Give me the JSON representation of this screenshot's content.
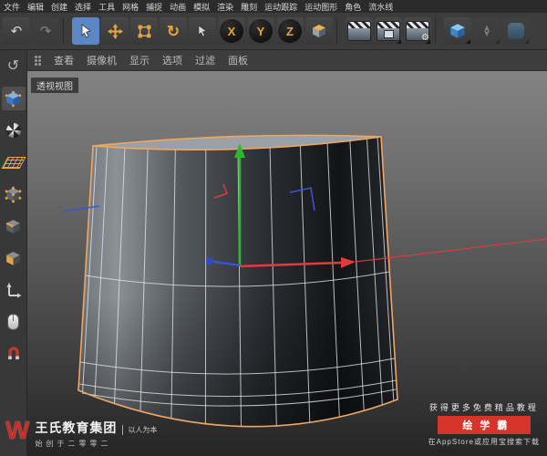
{
  "menubar": {
    "items": [
      "文件",
      "编辑",
      "创建",
      "选择",
      "工具",
      "网格",
      "捕捉",
      "动画",
      "模拟",
      "渲染",
      "雕刻",
      "运动跟踪",
      "运动图形",
      "角色",
      "流水线"
    ]
  },
  "toolbar": {
    "axis_buttons": [
      "X",
      "Y",
      "Z"
    ],
    "icon_glyphs": {
      "undo": "↶",
      "redo": "↷",
      "rotate": "↻",
      "gear": "⚙"
    },
    "icon_names": [
      "undo",
      "redo",
      "live-selection",
      "move",
      "scale",
      "rotate",
      "last-used-tool",
      "x-axis-lock",
      "y-axis-lock",
      "z-axis-lock",
      "coordinate-system",
      "render-view",
      "render-to-picture-viewer",
      "edit-render-settings",
      "add-primitive-cube",
      "pen",
      "subdivision-surface"
    ]
  },
  "left_toolbar": {
    "icon_names": [
      "make-editable",
      "model-mode",
      "texture-mode",
      "workplane-mode",
      "points-mode",
      "edges-mode",
      "polygons-mode",
      "enable-axis",
      "viewport-solo",
      "enable-snap"
    ]
  },
  "viewport": {
    "menu_items": [
      "查看",
      "摄像机",
      "显示",
      "选项",
      "过滤",
      "面板"
    ],
    "view_label": "透视视图"
  },
  "watermark": {
    "logo_letter": "W",
    "brand": "王氏教育集团",
    "slogan": "以人为本",
    "since": "始创于二零零二"
  },
  "promo": {
    "line1": "获得更多免费精品教程",
    "button_label": "绘学霸",
    "line2": "在AppStore或应用宝搜索下载"
  },
  "colors": {
    "accent_orange": "#e8a33d",
    "selection_highlight": "#5b87c5",
    "object_outline": "#efa763",
    "axis_x": "#e23b3b",
    "axis_y": "#2eb82e",
    "axis_z": "#3a55d9",
    "brand_red": "#d5342a"
  }
}
